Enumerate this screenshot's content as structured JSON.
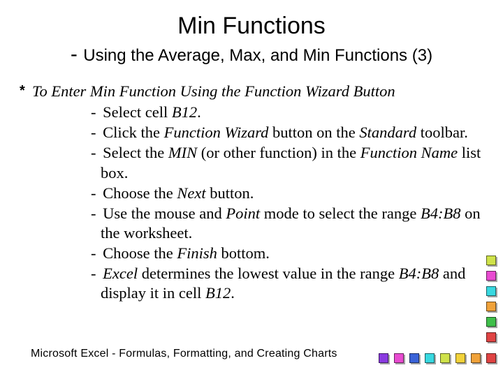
{
  "title": {
    "main": "Min Functions",
    "sub_prefix": "- ",
    "sub": "Using the Average, Max, and Min Functions (3)"
  },
  "heading": {
    "star": "*",
    "text": "To Enter Min Function Using the Function Wizard Button"
  },
  "steps": [
    {
      "pre": "Select cell ",
      "i1": "B12",
      "post": "."
    },
    {
      "pre": "Click the ",
      "i1": "Function Wizard",
      "mid1": " button on the ",
      "i2": "Standard",
      "post": " toolbar."
    },
    {
      "pre": "Select the ",
      "i1": "MIN",
      "mid1": " (or other function) in the ",
      "i2": "Function Name",
      "post": " list box."
    },
    {
      "pre": "Choose the ",
      "i1": "Next",
      "post": " button."
    },
    {
      "pre": "Use the mouse and ",
      "i1": "Point",
      "mid1": " mode to select the range ",
      "i2": "B4:B8",
      "post": " on the worksheet."
    },
    {
      "pre": "Choose the ",
      "i1": "Finish",
      "post": " bottom."
    },
    {
      "pre": "",
      "i1": "Excel",
      "mid1": " determines the lowest value in the range ",
      "i2": "B4:B8",
      "mid2": " and display it in cell ",
      "i3": "B12",
      "post": "."
    }
  ],
  "dash": "- ",
  "footer": "Microsoft  Excel - Formulas, Formatting, and Creating Charts"
}
